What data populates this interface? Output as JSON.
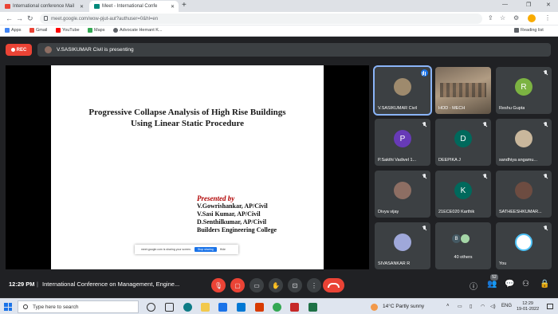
{
  "browser": {
    "tabs": [
      {
        "label": "International conference Mail",
        "favicon": "gmail-icon",
        "color": "#ea4335"
      },
      {
        "label": "Meet - International Confe",
        "favicon": "meet-icon",
        "color": "#00897b"
      }
    ],
    "new_tab": "+",
    "url": "meet.google.com/wow-pjut-aut?authuser=0&hl=en",
    "reading_list": "Reading list",
    "bookmarks": [
      {
        "label": "Apps",
        "color": "#4285f4"
      },
      {
        "label": "Gmail",
        "color": "#ea4335"
      },
      {
        "label": "YouTube",
        "color": "#ff0000"
      },
      {
        "label": "Maps",
        "color": "#34a853"
      },
      {
        "label": "Advocate Hemant K...",
        "color": "#5f6368"
      }
    ]
  },
  "meet": {
    "rec_label": "REC",
    "presenting_text": "V.SASIKUMAR Civil is presenting",
    "slide": {
      "title_line1": "Progressive Collapse Analysis  of High Rise Buildings",
      "title_line2": "Using Linear Static Procedure",
      "presented_by": "Presented by",
      "presenters": [
        "V.Gowrishankar, AP/Civil",
        "V.Sasi Kumar, AP/Civil",
        "D.Senthilkumar, AP/Civil",
        "Builders Engineering College"
      ]
    },
    "share_bar": {
      "text": "meet.google.com is sharing your screen.",
      "stop": "Stop sharing",
      "hide": "Hide"
    },
    "participants": [
      {
        "name": "V.SASIKUMAR Civil",
        "initial": "",
        "color": "#9e8a6d",
        "type": "photo",
        "speaking": true
      },
      {
        "name": "HOD - MECH",
        "initial": "",
        "color": "#7a6a5a",
        "type": "video",
        "speaking": false
      },
      {
        "name": "Reshu Gupta",
        "initial": "R",
        "color": "#7cb342",
        "type": "letter",
        "speaking": false
      },
      {
        "name": "P.Sakthi Vadivel 1...",
        "initial": "P",
        "color": "#673ab7",
        "type": "letter",
        "speaking": false
      },
      {
        "name": "DEEPIKA J",
        "initial": "D",
        "color": "#00695c",
        "type": "letter",
        "speaking": false
      },
      {
        "name": "sandhiya angamu...",
        "initial": "",
        "color": "#c9b79c",
        "type": "photo",
        "speaking": false
      },
      {
        "name": "Divya vijay",
        "initial": "",
        "color": "#8d6e63",
        "type": "photo",
        "speaking": false
      },
      {
        "name": "21ECE020 Karthik",
        "initial": "K",
        "color": "#00695c",
        "type": "letter",
        "speaking": false
      },
      {
        "name": "SATHEESHKUMAR...",
        "initial": "",
        "color": "#6d4c41",
        "type": "photo",
        "speaking": false
      },
      {
        "name": "SIVASANKAR R",
        "initial": "",
        "color": "#9fa8da",
        "type": "photo",
        "speaking": false
      },
      {
        "name": "40 others",
        "initial": "B",
        "color": "#455a64",
        "type": "others",
        "speaking": false
      },
      {
        "name": "You",
        "initial": "",
        "color": "#4fc3f7",
        "type": "photo",
        "speaking": false
      }
    ],
    "bottom": {
      "time": "12:29 PM",
      "separator": "|",
      "meeting_name": "International Conference on Management, Engine...",
      "participant_count": "52"
    }
  },
  "taskbar": {
    "search_placeholder": "Type here to search",
    "weather": "14°C  Partly sunny",
    "lang": "ENG",
    "time": "12:29",
    "date": "19-01-2022"
  }
}
